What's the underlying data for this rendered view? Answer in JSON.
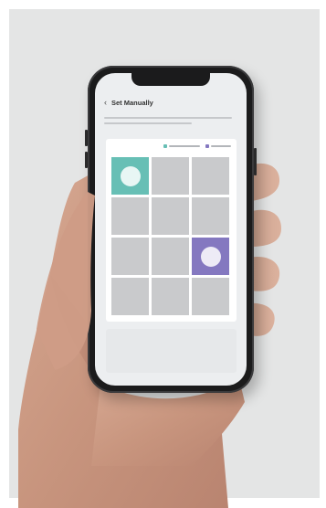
{
  "screen": {
    "title": "Set Manually",
    "back_icon": "chevron-left-icon",
    "description_lines": 2
  },
  "legend": [
    {
      "name": "teal-legend",
      "color": "#67bfb5"
    },
    {
      "name": "purple-legend",
      "color": "#8478c0"
    }
  ],
  "grid": {
    "rows": 4,
    "cols": 3,
    "cells": [
      {
        "state": "teal",
        "icon": "device-icon"
      },
      {
        "state": "empty"
      },
      {
        "state": "empty"
      },
      {
        "state": "empty"
      },
      {
        "state": "empty"
      },
      {
        "state": "empty"
      },
      {
        "state": "empty"
      },
      {
        "state": "empty"
      },
      {
        "state": "purple",
        "icon": "chat-bubbles-icon"
      },
      {
        "state": "empty"
      },
      {
        "state": "empty"
      },
      {
        "state": "empty"
      }
    ]
  },
  "colors": {
    "accent_teal": "#67bfb5",
    "accent_purple": "#8478c0",
    "empty_cell": "#c9cacc"
  }
}
